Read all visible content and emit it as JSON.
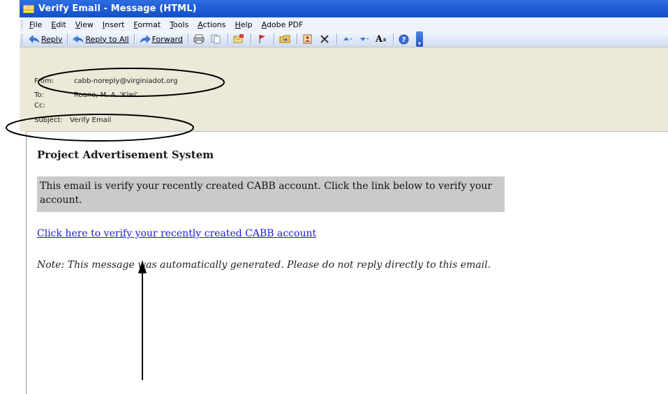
{
  "window": {
    "title": "Verify Email - Message (HTML)",
    "icon": "envelope-icon"
  },
  "menu": [
    "File",
    "Edit",
    "View",
    "Insert",
    "Format",
    "Tools",
    "Actions",
    "Help",
    "Adobe PDF"
  ],
  "toolbar": {
    "reply_label": "Reply",
    "reply_all_label": "Reply to All",
    "forward_label": "Forward",
    "font_size_glyph": "A",
    "icons": [
      "reply-icon",
      "reply-all-icon",
      "forward-icon",
      "print-icon",
      "copy-icon",
      "flag-envelope-icon",
      "followup-flag-icon",
      "move-to-folder-icon",
      "address-book-icon",
      "delete-icon",
      "previous-item-icon",
      "next-item-icon",
      "font-size-icon",
      "help-icon"
    ]
  },
  "header": {
    "from_key": "From:",
    "from_value": "cabb-noreply@virginiadot.org",
    "to_key": "To:",
    "to_value": "Roane, M. A. 'Kiwi'",
    "cc_key": "Cc:",
    "cc_value": "",
    "subject_key": "Subject:",
    "subject_value": "Verify Email"
  },
  "message": {
    "system_title": "Project Advertisement System",
    "notice_text": "This email is verify your recently created CABB account. Click the link below to verify your account.",
    "verify_link": "Click here to verify your recently created CABB account",
    "footer_note": "Note: This message was automatically generated. Please do not reply directly to this email."
  },
  "colors": {
    "titlebar": "#1f5cd6",
    "header_background": "#ece9d8",
    "notice_background": "#cacaca",
    "link": "#1a1ad6"
  }
}
